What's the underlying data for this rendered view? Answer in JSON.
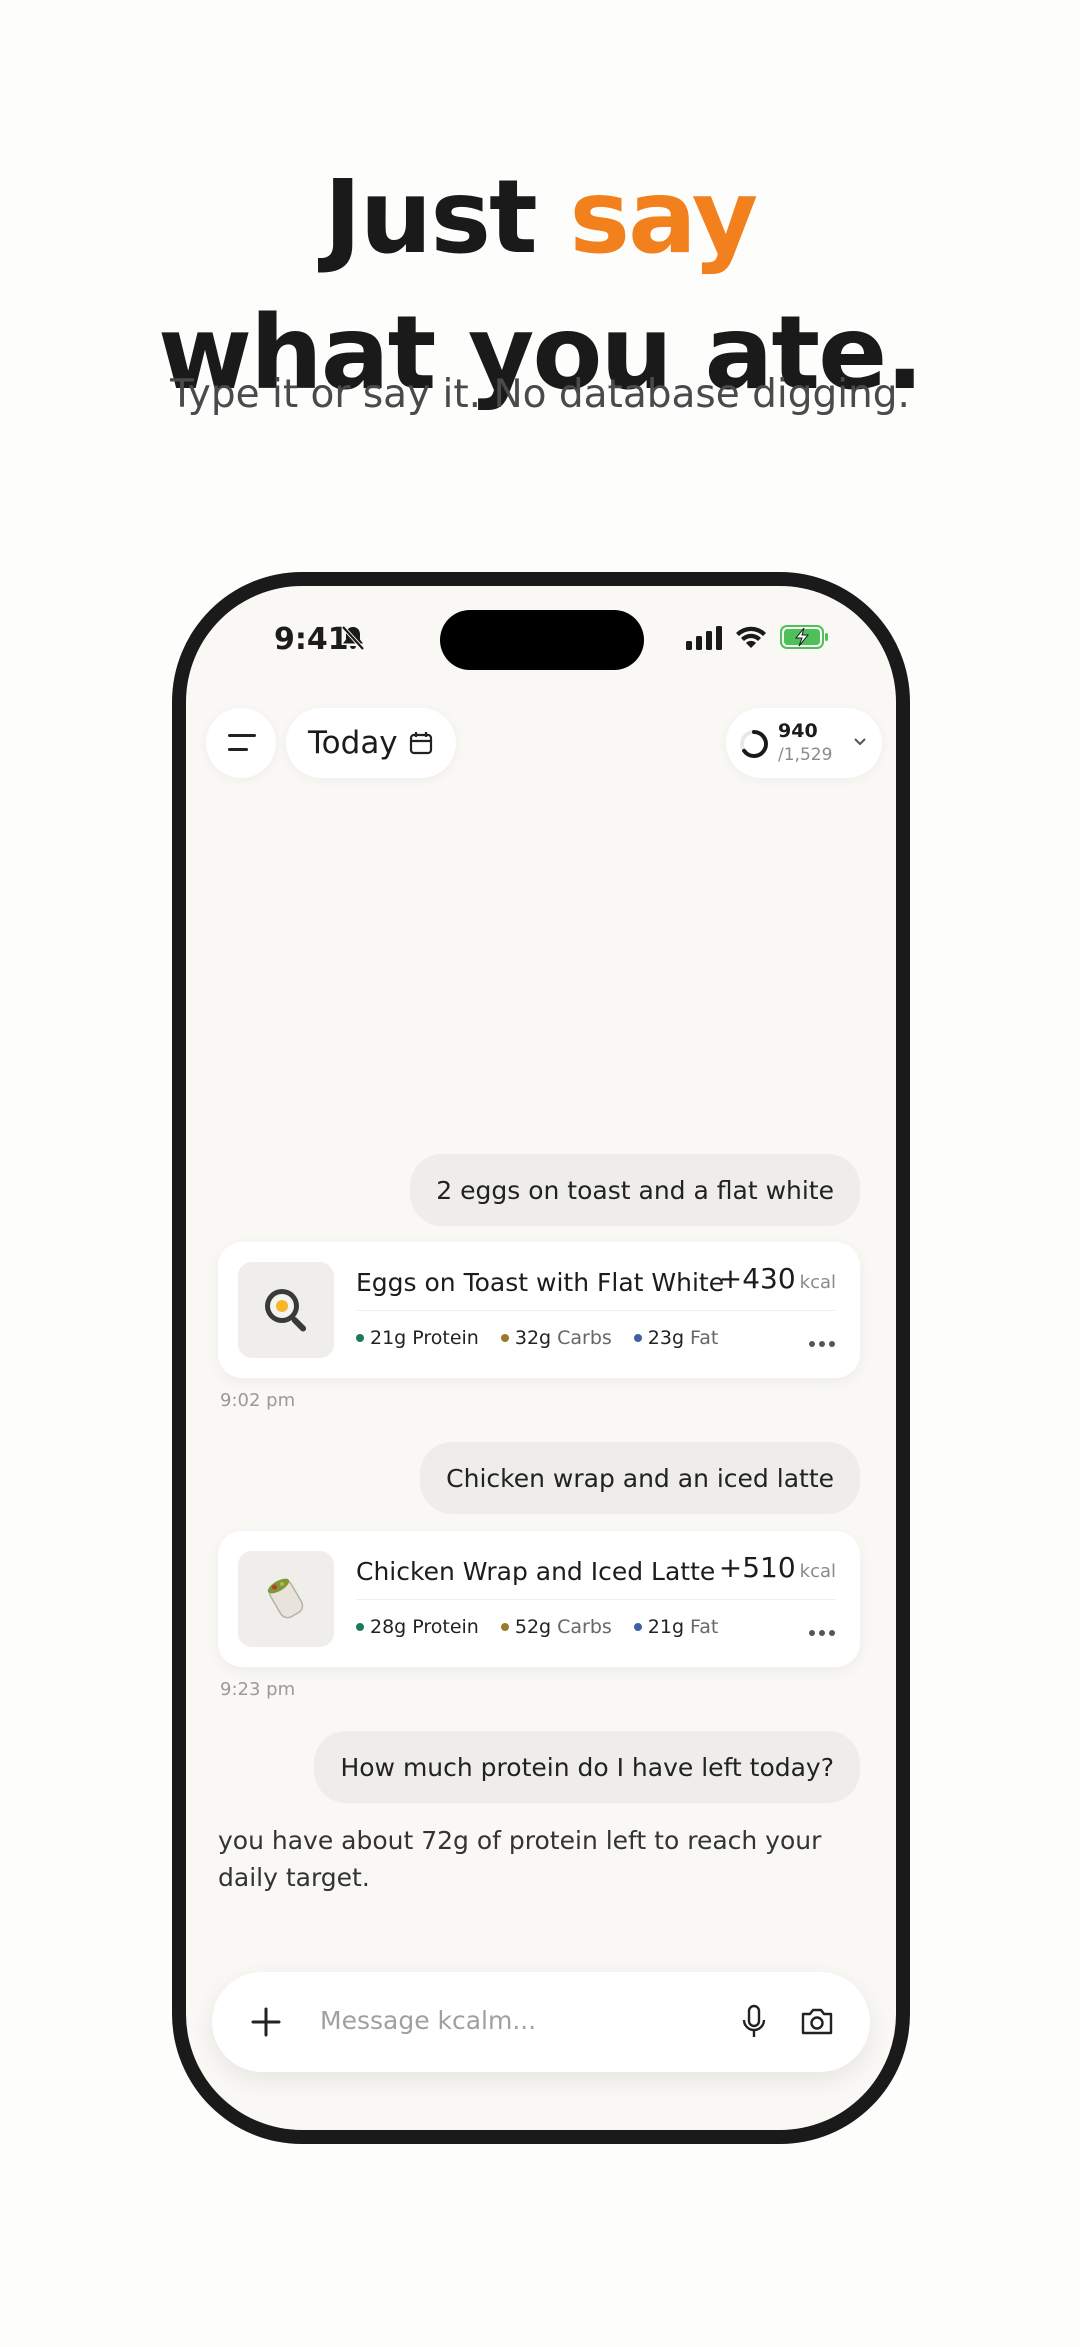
{
  "headline": {
    "line1_prefix": "Just ",
    "line1_accent": "say",
    "line2": "what you ate.",
    "subtitle": "Type it or say it. No database digging."
  },
  "status_bar": {
    "time": "9:41"
  },
  "header": {
    "today_label": "Today",
    "calories_consumed": "940",
    "calories_goal": "/1,529"
  },
  "messages": [
    {
      "role": "user",
      "text": "2 eggs on toast and a flat white"
    },
    {
      "role": "log",
      "title": "Eggs on Toast with Flat White",
      "kcal": "+430",
      "unit": "kcal",
      "protein": "21g",
      "carbs": "32g",
      "fat": "23g",
      "time": "9:02 pm",
      "icon": "frying-pan-egg-icon"
    },
    {
      "role": "user",
      "text": "Chicken wrap and an iced latte"
    },
    {
      "role": "log",
      "title": "Chicken Wrap and Iced Latte",
      "kcal": "+510",
      "unit": "kcal",
      "protein": "28g",
      "carbs": "52g",
      "fat": "21g",
      "time": "9:23 pm",
      "icon": "burrito-icon"
    },
    {
      "role": "user",
      "text": "How much protein do I have left today?"
    },
    {
      "role": "assistant",
      "text": "you have about 72g of protein left to reach your daily target."
    }
  ],
  "macro_labels": {
    "protein": "Protein",
    "carbs": "Carbs",
    "fat": "Fat"
  },
  "composer": {
    "placeholder": "Message kcalm..."
  },
  "colors": {
    "accent": "#f2811d",
    "protein": "#1e7a55",
    "carbs": "#9a7a2a",
    "fat": "#3f5fa0"
  }
}
